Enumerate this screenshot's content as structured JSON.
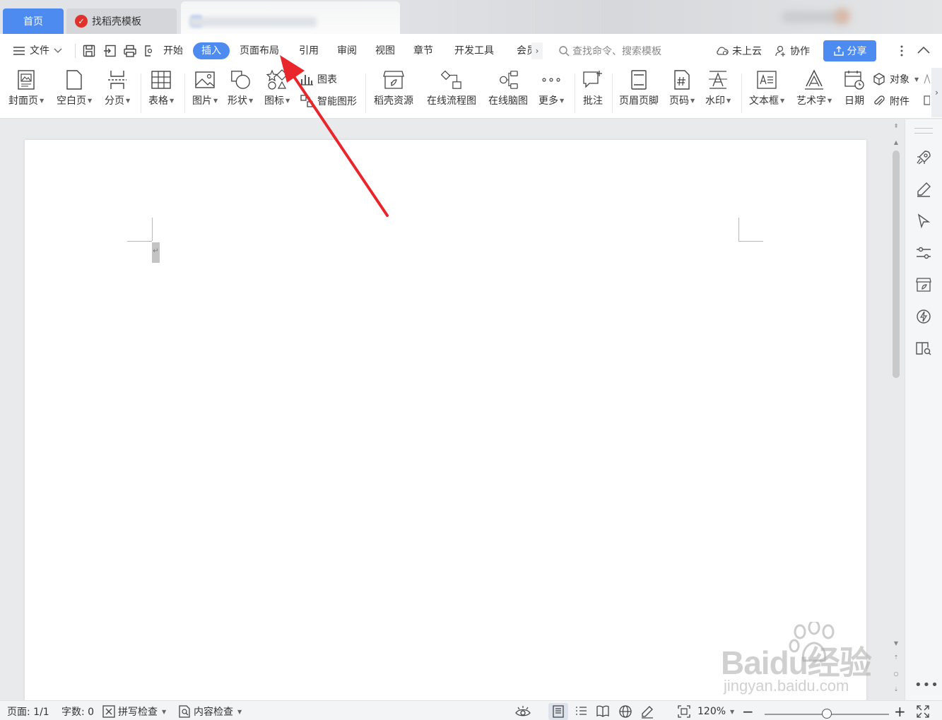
{
  "tabs": {
    "home": "首页",
    "daoke_templates": "找稻壳模板"
  },
  "menu": {
    "file": "文件",
    "items": [
      "开始",
      "插入",
      "页面布局",
      "引用",
      "审阅",
      "视图",
      "章节",
      "开发工具",
      "会员"
    ],
    "active": "插入",
    "search_placeholder": "查找命令、搜索模板",
    "cloud_status": "未上云",
    "collaborate": "协作",
    "share": "分享"
  },
  "ribbon": {
    "cover_page": "封面页",
    "blank_page": "空白页",
    "page_break": "分页",
    "table": "表格",
    "picture": "图片",
    "shape": "形状",
    "icon": "图标",
    "chart": "图表",
    "smart_art": "智能图形",
    "daoke_resources": "稻壳资源",
    "online_flowchart": "在线流程图",
    "online_mindmap": "在线脑图",
    "more": "更多",
    "comment": "批注",
    "header_footer": "页眉页脚",
    "page_number": "页码",
    "watermark": "水印",
    "text_box": "文本框",
    "word_art": "艺术字",
    "date": "日期",
    "object": "对象",
    "attachment": "附件"
  },
  "document": {
    "paragraph_mark": "↵"
  },
  "status": {
    "page": "页面: 1/1",
    "word_count": "字数: 0",
    "spell_check": "拼写检查",
    "content_check": "内容检查",
    "zoom": "120%",
    "zoom_level": 0.5
  },
  "watermark": {
    "brand": "Baidu经验",
    "url": "jingyan.baidu.com"
  },
  "colors": {
    "accent": "#4d8bf0",
    "arrow": "#e8262b"
  }
}
